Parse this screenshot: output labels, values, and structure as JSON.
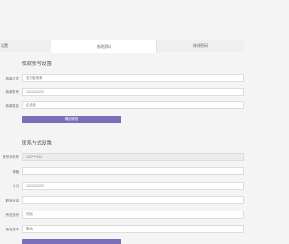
{
  "tabs": [
    {
      "label": "设置"
    },
    {
      "label": "修改资料"
    },
    {
      "label": "修改密码"
    }
  ],
  "payment": {
    "title": "收款账号设置:",
    "fields": [
      {
        "label": "收款方式",
        "value": "支付宝收款"
      },
      {
        "label": "收款账号",
        "value": "1212121212"
      },
      {
        "label": "收款姓名",
        "value": "企业版"
      }
    ],
    "submit_label": "确定修改"
  },
  "contact": {
    "title": "联系方式设置:",
    "fields": [
      {
        "label": "账号手机号",
        "value": "131****1111"
      },
      {
        "label": "邮箱",
        "value": ""
      },
      {
        "label": "Q Q",
        "value": "1212121212"
      },
      {
        "label": "联系电话",
        "value": ""
      },
      {
        "label": "所在省份",
        "value": "河北"
      },
      {
        "label": "所在城市",
        "value": "衡水"
      }
    ]
  }
}
